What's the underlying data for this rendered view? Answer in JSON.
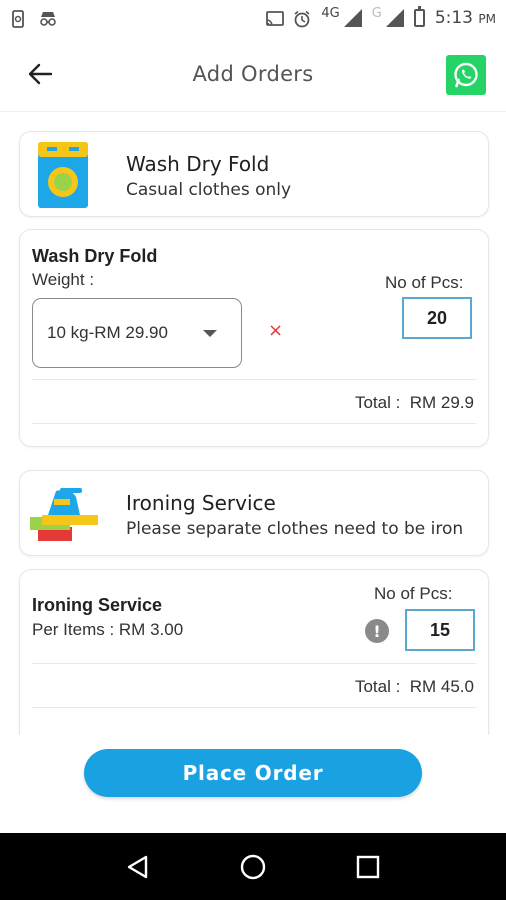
{
  "status_bar": {
    "network_primary": "4G",
    "network_secondary": "G",
    "time": "5:13",
    "time_suffix": "PM"
  },
  "app_bar": {
    "title": "Add Orders",
    "back_icon": "arrow-left-icon",
    "whatsapp_icon": "whatsapp-icon",
    "accent": "#25d366"
  },
  "services": [
    {
      "title": "Wash Dry Fold",
      "subtitle": "Casual clothes only",
      "icon": "washing-machine-icon"
    },
    {
      "title": "Ironing Service",
      "subtitle": "Please separate clothes need to be iron",
      "icon": "iron-icon"
    }
  ],
  "orders": [
    {
      "title": "Wash Dry Fold",
      "subtitle": "Weight :",
      "selected_option": "10 kg-RM 29.90",
      "remove_icon": "×",
      "pcs_label": "No of Pcs:",
      "quantity": "20",
      "total": "Total :  RM 29.9"
    },
    {
      "title": "Ironing Service",
      "subtitle": "Per Items : RM 3.00",
      "info_icon": "!",
      "pcs_label": "No of Pcs:",
      "quantity": "15",
      "total": "Total :  RM 45.0"
    }
  ],
  "actions": {
    "place_order": "Place Order",
    "accent": "#1aa1e1"
  }
}
